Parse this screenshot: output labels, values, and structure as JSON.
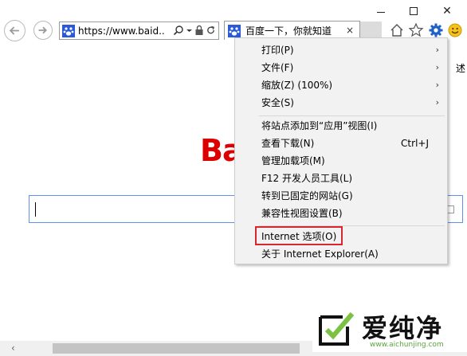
{
  "window": {
    "minimize_icon": "minimize-icon",
    "maximize_icon": "maximize-icon",
    "close_glyph": "✕"
  },
  "toolbar": {
    "address_url": "https://www.baid...",
    "tab_title": "百度一下，你就知道",
    "tab_close": "×",
    "icons": [
      "back-icon",
      "forward-icon",
      "search-icon",
      "lock-icon",
      "refresh-icon",
      "home-icon",
      "favorites-star-icon",
      "gear-icon",
      "smiley-icon"
    ]
  },
  "page": {
    "right_edge_text": "述",
    "logo_text": "Ba"
  },
  "menu": {
    "items": [
      {
        "label": "打印(P)",
        "submenu": "›"
      },
      {
        "label": "文件(F)",
        "submenu": "›"
      },
      {
        "label": "缩放(Z) (100%)",
        "submenu": "›"
      },
      {
        "label": "安全(S)",
        "submenu": "›"
      },
      {
        "label": "将站点添加到“应用”视图(I)"
      },
      {
        "label": "查看下载(N)",
        "shortcut": "Ctrl+J"
      },
      {
        "label": "管理加载项(M)"
      },
      {
        "label": "F12 开发人员工具(L)"
      },
      {
        "label": "转到已固定的网站(G)"
      },
      {
        "label": "兼容性视图设置(B)"
      },
      {
        "label": "Internet 选项(O)",
        "highlighted": true
      },
      {
        "label": "关于 Internet Explorer(A)"
      }
    ],
    "highlight_color": "#d9262e"
  },
  "scrollbar": {
    "left_arrow": "‹"
  },
  "watermark": {
    "text": "爱纯净",
    "url": "www.aichunjing.com"
  },
  "colors": {
    "baidu_red": "#dd0000",
    "search_border": "#5f8ff2",
    "ie_blue": "#1e62c4"
  }
}
